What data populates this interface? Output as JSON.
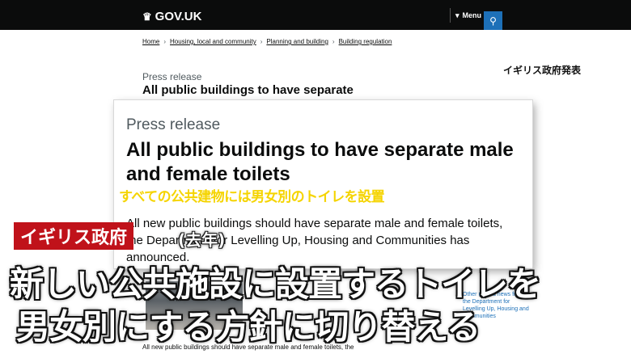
{
  "header": {
    "logo_icon": "crown-icon",
    "logo_text": "GOV.UK",
    "menu_label": "Menu",
    "search_icon": "search-icon",
    "background": "#0b0c0c",
    "accent": "#1d70b8"
  },
  "breadcrumb": {
    "items": [
      "Home",
      "Housing, local and community",
      "Planning and building",
      "Building regulation"
    ]
  },
  "article_top": {
    "kicker": "Press release",
    "title": "All public buildings to have separate"
  },
  "source_label": "イギリス政府発表",
  "zoom": {
    "kicker": "Press release",
    "title": "All public buildings to have separate male and female toilets",
    "body": "All new public buildings should have separate male and female toilets, the Department for Levelling Up, Housing and Communities has announced."
  },
  "captions": {
    "yellow": "すべての公共建物には男女別のトイレを設置",
    "tag": "イギリス政府",
    "tag_year": "(去年)",
    "line1": "新しい公共施設に設置するトイレを",
    "line2": "男女別にする方針に切り替える"
  },
  "bottom": {
    "blurb": "Other related news from the Department for Levelling Up, Housing and Communities",
    "text": "All new public buildings should have separate male and female toilets, the"
  }
}
